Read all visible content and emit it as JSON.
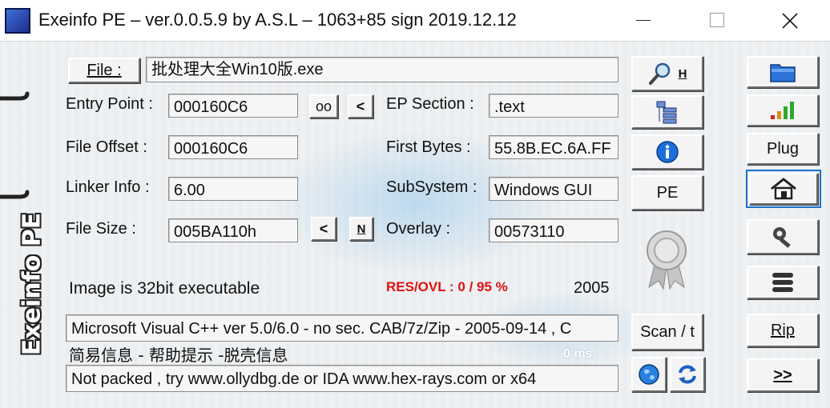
{
  "window": {
    "title": "Exeinfo PE – ver.0.0.5.9  by A.S.L –  1063+85 sign  2019.12.12"
  },
  "brand": {
    "text": "Exeinfo PE"
  },
  "file": {
    "button_label": "File :",
    "path": "批处理大全Win10版.exe"
  },
  "fields": {
    "entry_point": {
      "label": "Entry Point :",
      "value": "000160C6"
    },
    "file_offset": {
      "label": "File Offset :",
      "value": "000160C6"
    },
    "linker_info": {
      "label": "Linker Info :",
      "value": "6.00"
    },
    "file_size": {
      "label": "File Size :",
      "value": "005BA110h"
    },
    "ep_section": {
      "label": "EP Section :",
      "value": ".text"
    },
    "first_bytes": {
      "label": "First Bytes :",
      "value": "55.8B.EC.6A.FF"
    },
    "subsystem": {
      "label": "SubSystem :",
      "value": "Windows GUI"
    },
    "overlay": {
      "label": "Overlay :",
      "value": "00573110"
    }
  },
  "small_buttons": {
    "oo": "oo",
    "prev": "<",
    "size_prev": "<",
    "size_n": "N"
  },
  "middle_buttons": {
    "search_h": "H",
    "pe": "PE",
    "scan": "Scan / t"
  },
  "status": {
    "image_info": "Image is 32bit executable",
    "res_ovl": "RES/OVL : 0 / 95 %",
    "year": "2005",
    "detection": "Microsoft Visual C++ ver 5.0/6.0 - no sec. CAB/7z/Zip - 2005-09-14 , C",
    "cn_hint": "简易信息 - 帮助提示 -脱壳信息",
    "timer": "0 ms.",
    "advice": "Not packed , try  www.ollydbg.de or IDA  www.hex-rays.com  or  x64"
  },
  "right_buttons": {
    "plug": "Plug",
    "rip": "Rip",
    "next": ">>"
  },
  "icons": {
    "search": "magnifier-icon",
    "sections": "sections-list-icon",
    "info": "info-icon",
    "folder": "folder-icon",
    "signal": "signal-bars-icon",
    "home": "home-icon",
    "tools": "wrench-icon",
    "menu": "stack-icon",
    "globe": "globe-icon",
    "refresh": "refresh-icon",
    "seal": "award-seal-icon"
  },
  "colors": {
    "accent_focus": "#1e6fd0",
    "res_ovl": "#e01010"
  }
}
